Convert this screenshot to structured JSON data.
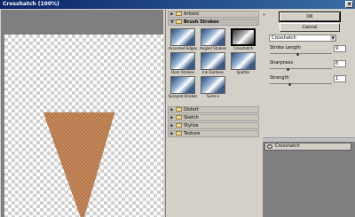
{
  "window": {
    "title": "Crosshatch (100%)",
    "close_label": "x"
  },
  "filter_browser": {
    "categories_top": [
      {
        "label": "Artistic",
        "expanded": false
      }
    ],
    "open_category": {
      "label": "Brush Strokes",
      "expanded": true
    },
    "thumbnails": [
      {
        "label": "Accented Edges",
        "selected": false
      },
      {
        "label": "Angled Strokes",
        "selected": false
      },
      {
        "label": "Crosshatch",
        "selected": true
      },
      {
        "label": "Dark Strokes",
        "selected": false
      },
      {
        "label": "Ink Outlines",
        "selected": false
      },
      {
        "label": "Spatter",
        "selected": false
      },
      {
        "label": "Sprayed Strokes",
        "selected": false
      },
      {
        "label": "Sumi-e",
        "selected": false
      }
    ],
    "categories_bottom": [
      {
        "label": "Distort"
      },
      {
        "label": "Sketch"
      },
      {
        "label": "Stylize"
      },
      {
        "label": "Texture"
      }
    ]
  },
  "settings": {
    "ok_label": "OK",
    "cancel_label": "Cancel",
    "filter_select_value": "Crosshatch",
    "params": [
      {
        "label": "Stroke Length",
        "value": "9",
        "level": 0.45
      },
      {
        "label": "Sharpness",
        "value": "6",
        "level": 0.3
      },
      {
        "label": "Strength",
        "value": "1",
        "level": 0.33
      }
    ]
  },
  "effect_layers": {
    "rows": [
      {
        "label": "Crosshatch"
      }
    ]
  },
  "colors": {
    "titlebar_start": "#0a246a",
    "panel": "#d4d0c8",
    "cone": "#c88c5e"
  }
}
